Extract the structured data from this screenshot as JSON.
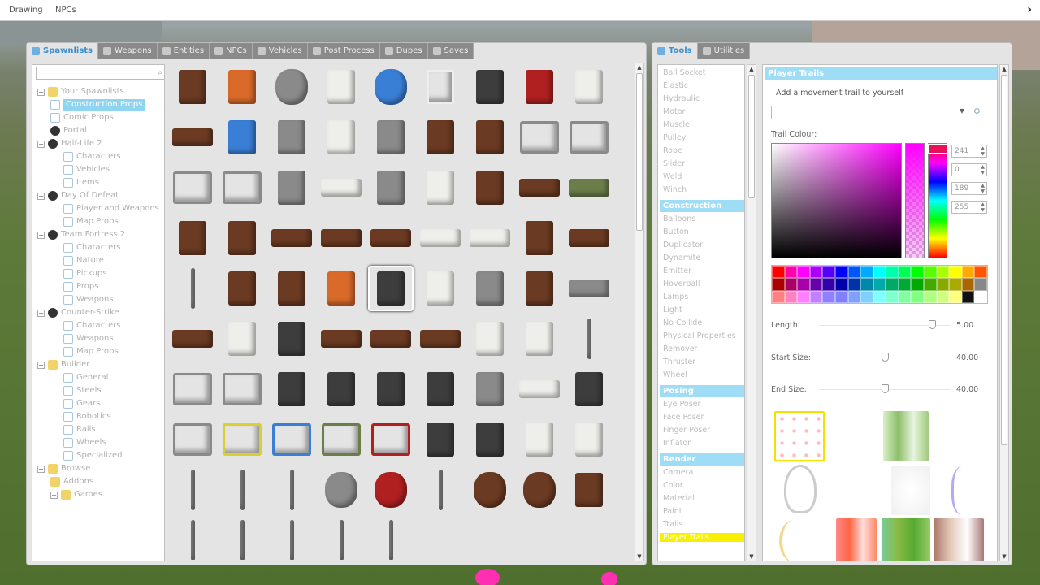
{
  "topbar": {
    "items": [
      "Drawing",
      "NPCs"
    ],
    "right_icon": "chevron-right-icon"
  },
  "spawn_tabs": [
    {
      "label": "Spawnlists",
      "icon": "list-icon",
      "active": true
    },
    {
      "label": "Weapons",
      "icon": "gun-icon",
      "active": false
    },
    {
      "label": "Entities",
      "icon": "entity-icon",
      "active": false
    },
    {
      "label": "NPCs",
      "icon": "npc-icon",
      "active": false
    },
    {
      "label": "Vehicles",
      "icon": "car-icon",
      "active": false
    },
    {
      "label": "Post Process",
      "icon": "image-icon",
      "active": false
    },
    {
      "label": "Dupes",
      "icon": "dupe-icon",
      "active": false
    },
    {
      "label": "Saves",
      "icon": "disk-icon",
      "active": false
    }
  ],
  "tree": [
    {
      "label": "Your Spawnlists",
      "depth": 0,
      "expander": "−",
      "icon": "folder"
    },
    {
      "label": "Construction Props",
      "depth": 1,
      "icon": "page",
      "selected": true
    },
    {
      "label": "Comic Props",
      "depth": 1,
      "icon": "page"
    },
    {
      "label": "Portal",
      "depth": 1,
      "icon": "game"
    },
    {
      "label": "Half-Life 2",
      "depth": 0,
      "expander": "−",
      "icon": "game"
    },
    {
      "label": "Characters",
      "depth": 2,
      "icon": "page"
    },
    {
      "label": "Vehicles",
      "depth": 2,
      "icon": "page"
    },
    {
      "label": "Items",
      "depth": 2,
      "icon": "page"
    },
    {
      "label": "Day Of Defeat",
      "depth": 0,
      "expander": "−",
      "icon": "game"
    },
    {
      "label": "Player and Weapons",
      "depth": 2,
      "icon": "page"
    },
    {
      "label": "Map Props",
      "depth": 2,
      "icon": "page"
    },
    {
      "label": "Team Fortress 2",
      "depth": 0,
      "expander": "−",
      "icon": "game"
    },
    {
      "label": "Characters",
      "depth": 2,
      "icon": "page"
    },
    {
      "label": "Nature",
      "depth": 2,
      "icon": "page"
    },
    {
      "label": "Pickups",
      "depth": 2,
      "icon": "page"
    },
    {
      "label": "Props",
      "depth": 2,
      "icon": "page"
    },
    {
      "label": "Weapons",
      "depth": 2,
      "icon": "page"
    },
    {
      "label": "Counter-Strike",
      "depth": 0,
      "expander": "−",
      "icon": "game"
    },
    {
      "label": "Characters",
      "depth": 2,
      "icon": "page"
    },
    {
      "label": "Weapons",
      "depth": 2,
      "icon": "page"
    },
    {
      "label": "Map Props",
      "depth": 2,
      "icon": "page"
    },
    {
      "label": "Builder",
      "depth": 0,
      "expander": "−",
      "icon": "folder"
    },
    {
      "label": "General",
      "depth": 2,
      "icon": "page"
    },
    {
      "label": "Steels",
      "depth": 2,
      "icon": "page"
    },
    {
      "label": "Gears",
      "depth": 2,
      "icon": "page"
    },
    {
      "label": "Robotics",
      "depth": 2,
      "icon": "page"
    },
    {
      "label": "Rails",
      "depth": 2,
      "icon": "page"
    },
    {
      "label": "Wheels",
      "depth": 2,
      "icon": "page"
    },
    {
      "label": "Specialized",
      "depth": 2,
      "icon": "page"
    },
    {
      "label": "Browse",
      "depth": 0,
      "expander": "−",
      "icon": "folder"
    },
    {
      "label": "Addons",
      "depth": 1,
      "icon": "folder"
    },
    {
      "label": "Games",
      "depth": 1,
      "expander": "+",
      "icon": "folder"
    }
  ],
  "props": [
    "stool",
    "orange-bins",
    "valve-wheel",
    "wall-panel",
    "blue-barrel",
    "cage-locker",
    "dark-canister",
    "red-canister",
    "water-heater",
    "bench",
    "blue-chair",
    "lamp-post",
    "sign-board",
    "display-case",
    "door",
    "wood-door",
    "fence-panel",
    "fence",
    "fence",
    "fence",
    "fountain",
    "bathtub",
    "bed-frame",
    "heater",
    "chair",
    "sofa",
    "green-sofa",
    "cabinet",
    "drawer",
    "drawer-tray",
    "drawer-tray",
    "plank",
    "mattress",
    "mattress",
    "wardrobe",
    "table-low",
    "pole",
    "desk",
    "tall-cabinet",
    "cabinet-orange",
    "stove",
    "fridge",
    "radiator",
    "shelf",
    "glass-pane",
    "bench-frame",
    "sink",
    "oven",
    "round-table",
    "table",
    "table",
    "cup",
    "washing-machine",
    "pole-thin",
    "gate",
    "double-gate",
    "grave",
    "gravestone",
    "tombstone",
    "tomb",
    "cross-slab",
    "bathtub-small",
    "statue",
    "crate-frame",
    "crate-yellow",
    "crate-blue",
    "crate-green",
    "crate-red",
    "pillar",
    "statue-thin",
    "lampshade",
    "locker",
    "pipe",
    "pipe",
    "hook-pipe",
    "rusty-barrel",
    "explosive-barrel",
    "hook",
    "spool",
    "spool",
    "pallet",
    "rod",
    "broom",
    "rod",
    "rod",
    "rod"
  ],
  "tool_tabs": [
    {
      "label": "Tools",
      "icon": "wrench-icon",
      "active": true
    },
    {
      "label": "Utilities",
      "icon": "utility-icon",
      "active": false
    }
  ],
  "tools": [
    {
      "label": "Ball Socket"
    },
    {
      "label": "Elastic"
    },
    {
      "label": "Hydraulic"
    },
    {
      "label": "Motor"
    },
    {
      "label": "Muscle"
    },
    {
      "label": "Pulley"
    },
    {
      "label": "Rope"
    },
    {
      "label": "Slider"
    },
    {
      "label": "Weld"
    },
    {
      "label": "Winch"
    },
    {
      "label": "Construction",
      "header": true
    },
    {
      "label": "Balloons"
    },
    {
      "label": "Button"
    },
    {
      "label": "Duplicator"
    },
    {
      "label": "Dynamite"
    },
    {
      "label": "Emitter"
    },
    {
      "label": "Hoverball"
    },
    {
      "label": "Lamps"
    },
    {
      "label": "Light"
    },
    {
      "label": "No Collide"
    },
    {
      "label": "Physical Properties"
    },
    {
      "label": "Remover"
    },
    {
      "label": "Thruster"
    },
    {
      "label": "Wheel"
    },
    {
      "label": "Posing",
      "header": true
    },
    {
      "label": "Eye Poser"
    },
    {
      "label": "Face Poser"
    },
    {
      "label": "Finger Poser"
    },
    {
      "label": "Inflator"
    },
    {
      "label": "Render",
      "header": true
    },
    {
      "label": "Camera"
    },
    {
      "label": "Color"
    },
    {
      "label": "Material"
    },
    {
      "label": "Paint"
    },
    {
      "label": "Trails"
    },
    {
      "label": "Player Trails",
      "highlight": true
    }
  ],
  "options": {
    "title": "Player Trails",
    "description": "Add a movement trail to yourself",
    "combo_value": "",
    "trail_colour_label": "Trail Colour:",
    "rgba": [
      "241",
      "0",
      "189",
      "255"
    ],
    "length": {
      "label": "Length:",
      "value": "5.00",
      "fraction": 0.86
    },
    "start_size": {
      "label": "Start Size:",
      "value": "40.00",
      "fraction": 0.5
    },
    "end_size": {
      "label": "End Size:",
      "value": "40.00",
      "fraction": 0.5
    }
  },
  "palette_colors": [
    "#ff0000",
    "#ff00aa",
    "#ff00ff",
    "#aa00ff",
    "#5500ff",
    "#0000ff",
    "#0055ff",
    "#00aaff",
    "#00ffff",
    "#00ffaa",
    "#00ff55",
    "#00ff00",
    "#55ff00",
    "#aaff00",
    "#ffff00",
    "#ffaa00",
    "#ff5500",
    "#aa0000",
    "#aa0066",
    "#aa00aa",
    "#6600aa",
    "#3300aa",
    "#0000aa",
    "#0033aa",
    "#0088aa",
    "#00aaaa",
    "#00aa66",
    "#00aa33",
    "#00aa00",
    "#44aa00",
    "#88aa00",
    "#aaaa00",
    "#aa6600",
    "#888888",
    "#ff8080",
    "#ff80c0",
    "#ff80ff",
    "#c080ff",
    "#9080ff",
    "#8080ff",
    "#80a0ff",
    "#80d0ff",
    "#80ffff",
    "#80ffd0",
    "#80ffa0",
    "#80ff80",
    "#b0ff80",
    "#d0ff80",
    "#ffff80",
    "#111111",
    "#ffffff"
  ],
  "colors": {
    "accent": "#9fdcf5",
    "highlight": "#f8f000",
    "selected_color": "#e8105a"
  }
}
